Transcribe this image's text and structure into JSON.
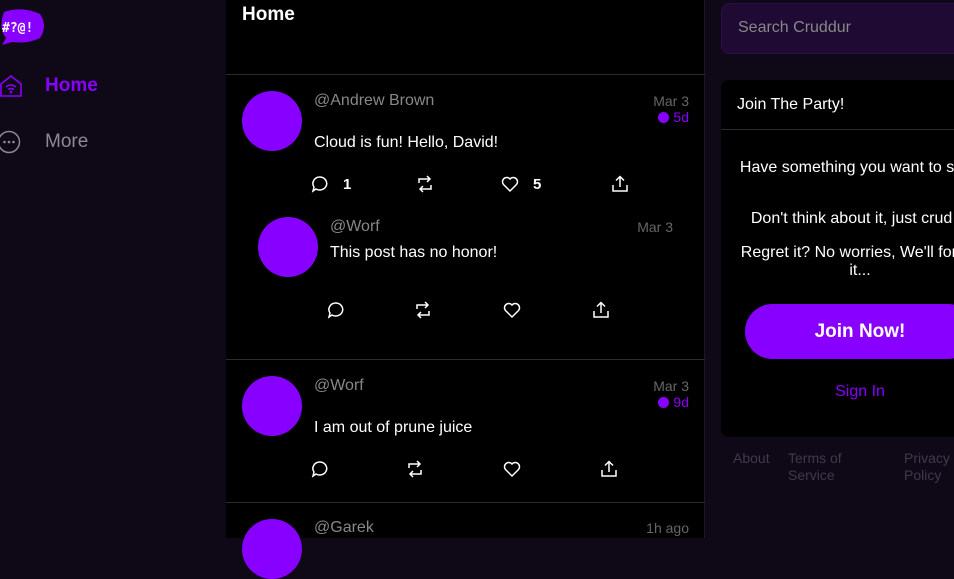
{
  "logo": {
    "text": "#?@!"
  },
  "sidebar": {
    "items": [
      {
        "label": "Home",
        "icon": "home-icon",
        "active": true
      },
      {
        "label": "More",
        "icon": "more-icon"
      }
    ]
  },
  "main": {
    "title": "Home",
    "posts": [
      {
        "handle": "@Andrew Brown",
        "date": "Mar 3",
        "expires": "5d",
        "message": "Cloud is fun! Hello, David!",
        "replies": "1",
        "reposts": "",
        "likes": "5"
      },
      {
        "handle": "@Worf",
        "date": "Mar 3",
        "message": "This post has no honor!",
        "is_reply": true
      },
      {
        "handle": "@Worf",
        "date": "Mar 3",
        "expires": "9d",
        "message": "I am out of prune juice"
      },
      {
        "handle": "@Garek",
        "date": "1h ago"
      }
    ]
  },
  "search": {
    "placeholder": "Search Cruddur"
  },
  "join_card": {
    "title": "Join The Party!",
    "line1": "Have something you want to say?",
    "line2": "Don't think about it, just crud it!",
    "line3": "Regret it? No worries, We'll forget it...",
    "join_label": "Join Now!",
    "signin_label": "Sign In"
  },
  "footer": {
    "about": "About",
    "terms": "Terms of Service",
    "privacy": "Privacy Policy"
  },
  "colors": {
    "accent": "#8800ff",
    "sidebar_bg": "#0f0817",
    "main_bg": "#000000"
  }
}
